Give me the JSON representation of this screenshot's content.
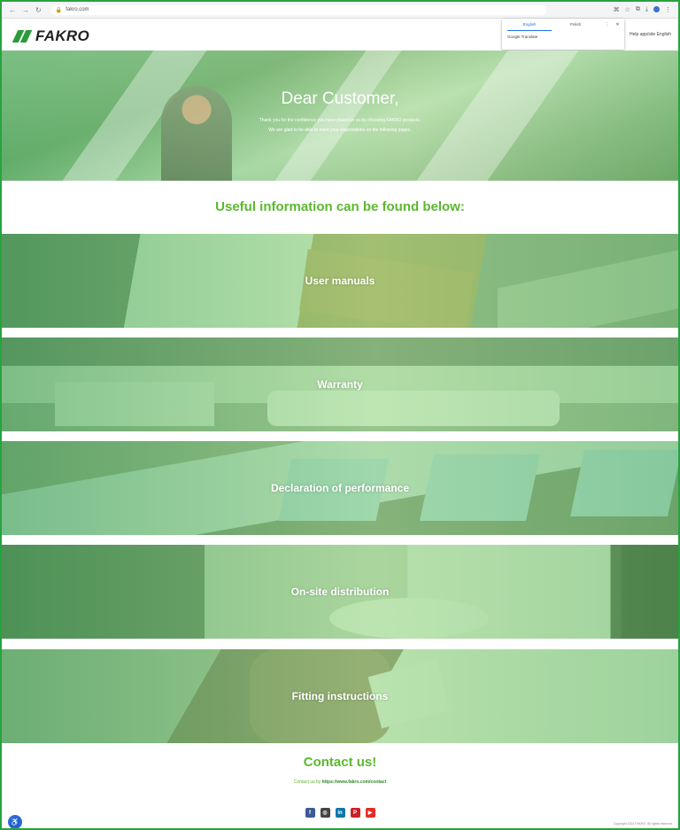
{
  "browser": {
    "url": "fakro.com",
    "nav_icons": [
      "back-icon",
      "forward-icon",
      "reload-icon"
    ]
  },
  "header": {
    "logo_text": "FAKRO",
    "right_text": "Help app/site  English"
  },
  "translate_popup": {
    "tab_source": "English",
    "tab_target": "Polish",
    "controls": "⋮ ✕",
    "option": "Google Translate"
  },
  "hero": {
    "title": "Dear Customer,",
    "line1": "Thank you for the confidence you have placed in us by choosing FAKRO products.",
    "line2": "We are glad to be able to meet your expectations on the following pages."
  },
  "useful": {
    "heading": "Useful information can be found below:"
  },
  "banners": [
    {
      "label": "User manuals"
    },
    {
      "label": "Warranty"
    },
    {
      "label": "Declaration of performance"
    },
    {
      "label": "On-site distribution"
    },
    {
      "label": "Fitting instructions"
    }
  ],
  "contact": {
    "heading": "Contact us!",
    "prefix": "Contact us by",
    "link": "https://www.fakro.com/contact"
  },
  "social": [
    {
      "icon": "facebook-icon",
      "glyph": "f",
      "color": "#3b5998"
    },
    {
      "icon": "instagram-icon",
      "glyph": "◎",
      "color": "#444444"
    },
    {
      "icon": "linkedin-icon",
      "glyph": "in",
      "color": "#0e76a8"
    },
    {
      "icon": "pinterest-icon",
      "glyph": "P",
      "color": "#cb2027"
    },
    {
      "icon": "youtube-icon",
      "glyph": "▶",
      "color": "#e52d27"
    }
  ],
  "footer": {
    "copyright": "Copyright 2024 FAKRO. All rights reserved."
  },
  "colors": {
    "brand_green": "#5cb82f",
    "frame": "#27a33f"
  }
}
